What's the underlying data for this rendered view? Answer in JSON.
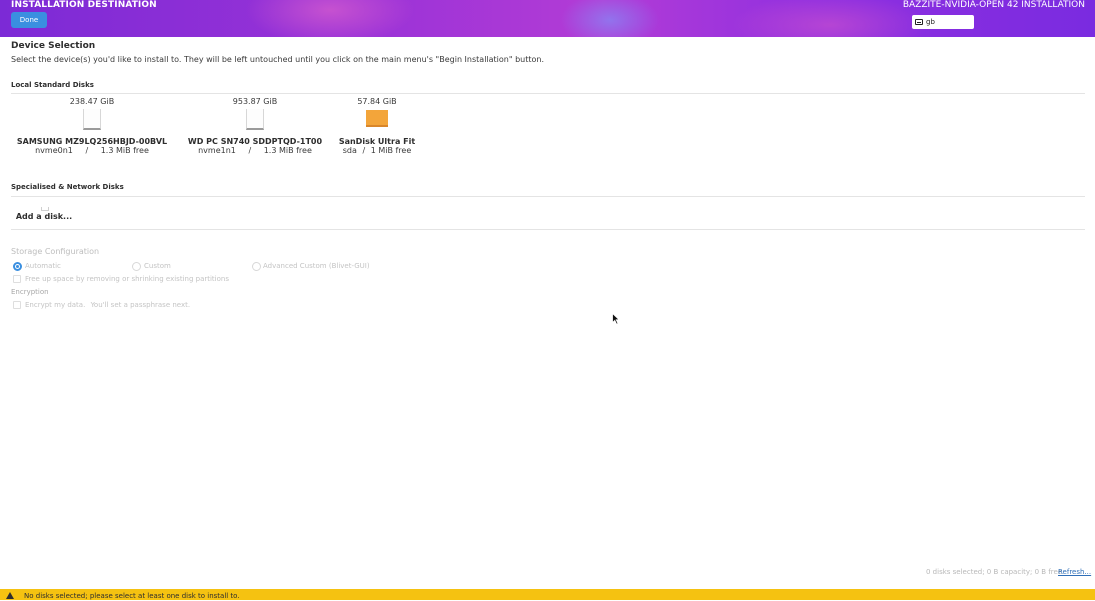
{
  "header": {
    "title": "INSTALLATION DESTINATION",
    "done_label": "Done",
    "product": "BAZZITE-NVIDIA-OPEN 42 INSTALLATION",
    "keyboard_layout": "gb"
  },
  "device_selection": {
    "title": "Device Selection",
    "instructions": "Select the device(s) you'd like to install to.  They will be left untouched until you click on the main menu's \"Begin Installation\" button."
  },
  "local_disks": {
    "heading": "Local Standard Disks",
    "disks": [
      {
        "capacity": "238.47 GiB",
        "name": "SAMSUNG MZ9LQ256HBJD-00BVL",
        "device": "nvme0n1",
        "sep": "/",
        "free": "1.3 MiB free"
      },
      {
        "capacity": "953.87 GiB",
        "name": "WD PC SN740 SDDPTQD-1T00",
        "device": "nvme1n1",
        "sep": "/",
        "free": "1.3 MiB free"
      },
      {
        "capacity": "57.84 GiB",
        "name": "SanDisk Ultra Fit",
        "device": "sda",
        "sep": "/",
        "free": "1 MiB free"
      }
    ]
  },
  "network_disks": {
    "heading": "Specialised & Network Disks",
    "add_label": "Add a disk..."
  },
  "storage": {
    "heading": "Storage Configuration",
    "options": [
      "Automatic",
      "Custom",
      "Advanced Custom (Blivet-GUI)"
    ],
    "free_space_label": "Free up space by removing or shrinking existing partitions",
    "encryption_heading": "Encryption",
    "encrypt_label": "Encrypt my data.",
    "encrypt_note": "You'll set a passphrase next."
  },
  "footer": {
    "summary": "0 disks selected; 0 B capacity; 0 B free",
    "refresh_label": "Refresh..."
  },
  "warning": {
    "message": "No disks selected; please select at least one disk to install to."
  },
  "colors": {
    "header_purple": "#9c33d7",
    "accent_blue": "#3a8fe0",
    "usb_orange": "#f3a53a",
    "warning_yellow": "#f5c211"
  }
}
